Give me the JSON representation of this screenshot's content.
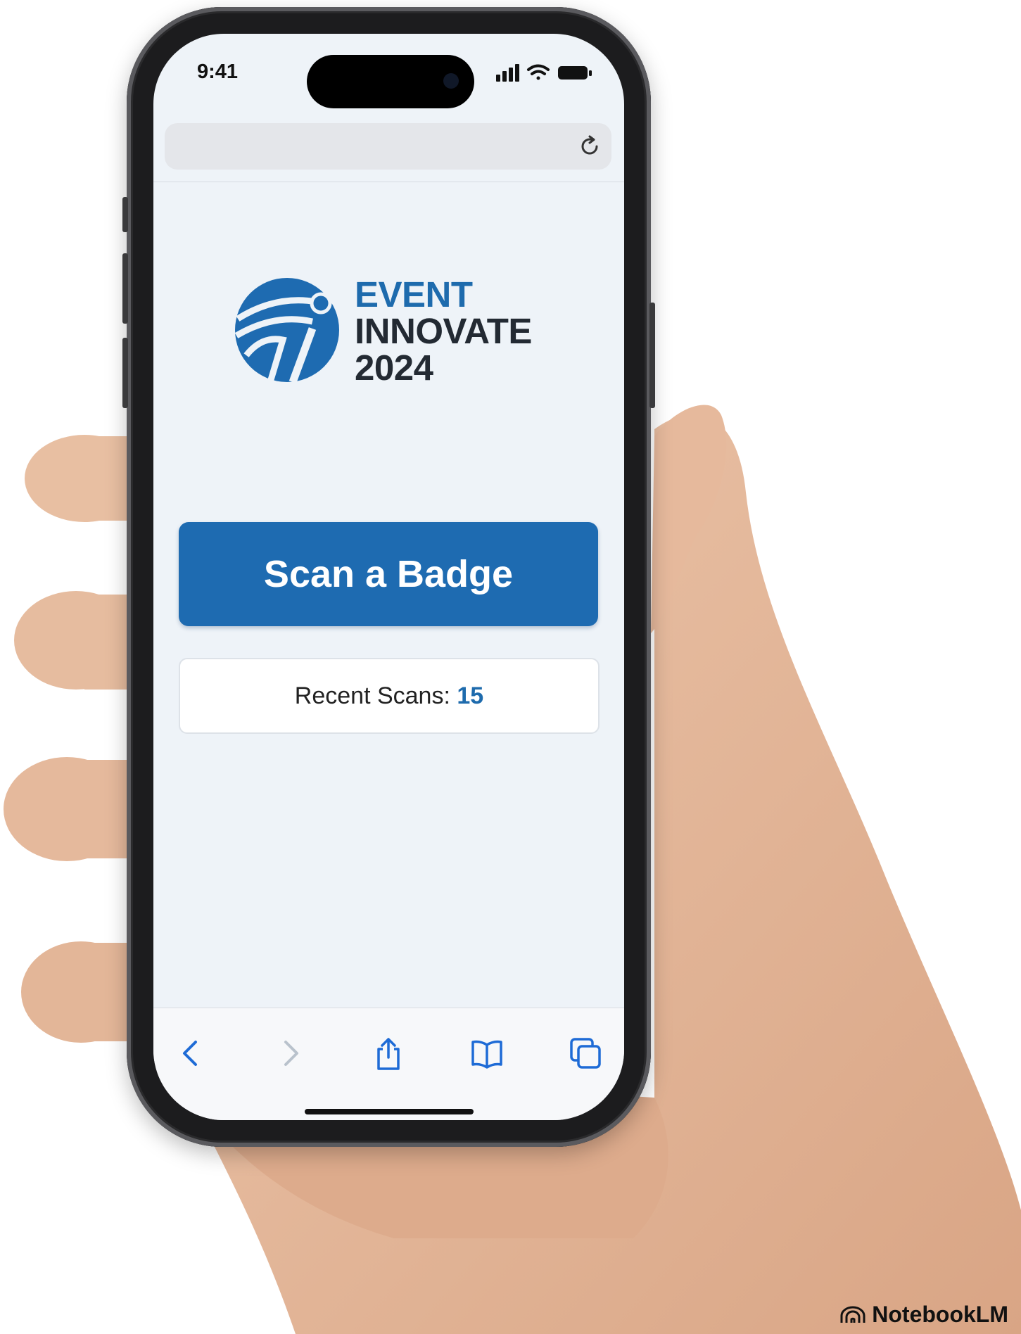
{
  "status_bar": {
    "time": "9:41"
  },
  "browser": {
    "url_text": "",
    "toolbar_icons": [
      "back-icon",
      "forward-icon",
      "share-icon",
      "bookmarks-icon",
      "tabs-icon"
    ]
  },
  "event": {
    "logo_line1": "EVENT",
    "logo_line2": "INNOVATE",
    "logo_line3": "2024"
  },
  "actions": {
    "scan_label": "Scan a Badge"
  },
  "recent": {
    "label": "Recent Scans:",
    "count": "15"
  },
  "footer": {
    "brand": "NotebookLM"
  },
  "colors": {
    "accent": "#1e6bb1",
    "text_dark": "#232a33",
    "screen_bg": "#eef3f8",
    "skin": "#e2b79a"
  }
}
